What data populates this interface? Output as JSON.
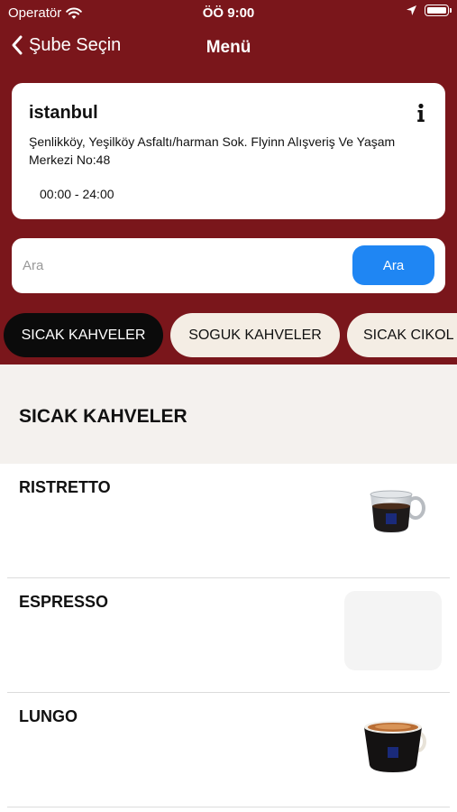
{
  "status_bar": {
    "carrier": "Operatör",
    "time": "ÖÖ 9:00",
    "icons": [
      "wifi-icon",
      "location-arrow-icon",
      "battery-icon"
    ]
  },
  "nav": {
    "back_label": "Şube Seçin",
    "title": "Menü",
    "back_icon": "chevron-left-icon"
  },
  "branch": {
    "name": "istanbul",
    "address": "Şenlikköy, Yeşilköy Asfaltı/harman Sok. Flyinn Alışveriş Ve Yaşam Merkezi No:48",
    "hours": "00:00 - 24:00",
    "info_icon": "info-icon"
  },
  "search": {
    "placeholder": "Ara",
    "value": "",
    "button_label": "Ara"
  },
  "categories": [
    {
      "label": "SICAK KAHVELER",
      "active": true
    },
    {
      "label": "SOGUK KAHVELER",
      "active": false
    },
    {
      "label": "SICAK CIKOL",
      "active": false
    }
  ],
  "section": {
    "title": "SICAK KAHVELER"
  },
  "menu_items": [
    {
      "name": "RISTRETTO",
      "thumbnail": "espresso-cup-image"
    },
    {
      "name": "ESPRESSO",
      "thumbnail": "empty-placeholder"
    },
    {
      "name": "LUNGO",
      "thumbnail": "lungo-cup-image"
    }
  ],
  "colors": {
    "header_bg": "#7a161b",
    "search_button": "#1f86f3",
    "active_tab": "#0b0b0b",
    "inactive_tab": "#f4ede4",
    "section_bg": "#f4f1ee"
  }
}
